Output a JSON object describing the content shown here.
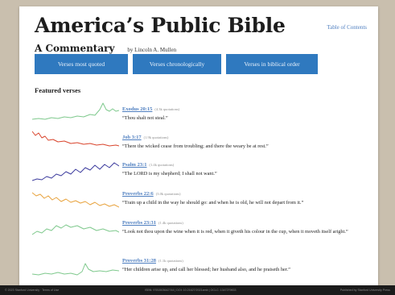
{
  "header": {
    "title": "America’s Public Bible",
    "subtitle": "A Commentary",
    "byline": "by Lincoln A. Mullen",
    "toc_link": "Table of Contents"
  },
  "nav": {
    "buttons": [
      "Verses most quoted",
      "Verses chronologically",
      "Verses in biblical order"
    ],
    "color": "#2f79bf"
  },
  "featured": {
    "heading": "Featured verses",
    "verses": [
      {
        "ref": "Exodus 20:15",
        "count": "(4.3k quotations)",
        "text": "“Thou shalt not steal.”",
        "color": "#7fc98d"
      },
      {
        "ref": "Job 3:17",
        "count": "(1.9k quotations)",
        "text": "“There the wicked cease from troubling; and there the weary be at rest.”",
        "color": "#d9452d"
      },
      {
        "ref": "Psalm 23:1",
        "count": "(1.4k quotations)",
        "text": "“The LORD is my shepherd; I shall not want.”",
        "color": "#3d3c9e"
      },
      {
        "ref": "Proverbs 22:6",
        "count": "(3.0k quotations)",
        "text": "“Train up a child in the way he should go: and when he is old, he will not depart from it.”",
        "color": "#e8a33e"
      },
      {
        "ref": "Proverbs 23:31",
        "count": "(1.4k quotations)",
        "text": "“Look not thou upon the wine when it is red, when it giveth his colour in the cup, when it moveth itself aright.”",
        "color": "#7fc98d"
      },
      {
        "ref": "Proverbs 31:28",
        "count": "(1.1k quotations)",
        "text": "“Her children arise up, and call her blessed; her husband also, and he praiseth her.”",
        "color": "#7fc98d"
      }
    ]
  },
  "footer": {
    "copyright": "© 2023 Stanford University · Terms of Use",
    "isbn": "ISBN: 9781503642744 | DOI: 10.21627/2021amb | OCLC: 1347279833",
    "publisher": "Published by Stanford University Press"
  }
}
